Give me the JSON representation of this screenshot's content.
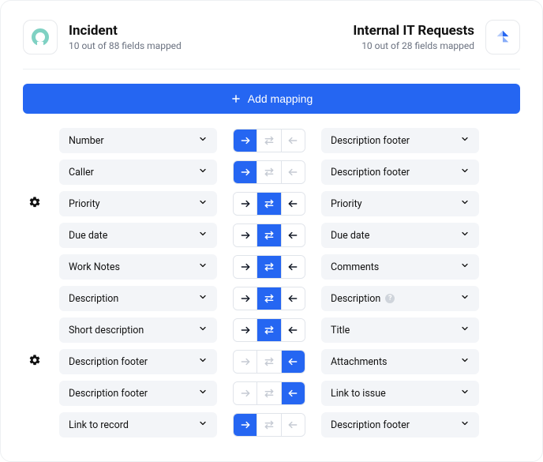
{
  "left": {
    "title": "Incident",
    "subtitle": "10 out of 88 fields mapped"
  },
  "right": {
    "title": "Internal IT Requests",
    "subtitle": "10 out of 28 fields mapped"
  },
  "add_mapping_label": "Add mapping",
  "rows": [
    {
      "gear": false,
      "left": "Number",
      "active": "right",
      "mutedOthers": true,
      "right": "Description footer",
      "help": false
    },
    {
      "gear": false,
      "left": "Caller",
      "active": "right",
      "mutedOthers": true,
      "right": "Description footer",
      "help": false
    },
    {
      "gear": true,
      "left": "Priority",
      "active": "both",
      "mutedOthers": false,
      "right": "Priority",
      "help": false
    },
    {
      "gear": false,
      "left": "Due date",
      "active": "both",
      "mutedOthers": false,
      "right": "Due date",
      "help": false
    },
    {
      "gear": false,
      "left": "Work Notes",
      "active": "both",
      "mutedOthers": false,
      "right": "Comments",
      "help": false
    },
    {
      "gear": false,
      "left": "Description",
      "active": "both",
      "mutedOthers": false,
      "right": "Description",
      "help": true
    },
    {
      "gear": false,
      "left": "Short description",
      "active": "both",
      "mutedOthers": false,
      "right": "Title",
      "help": false
    },
    {
      "gear": true,
      "left": "Description footer",
      "active": "left",
      "mutedOthers": true,
      "right": "Attachments",
      "help": false
    },
    {
      "gear": false,
      "left": "Description footer",
      "active": "left",
      "mutedOthers": true,
      "right": "Link to issue",
      "help": false
    },
    {
      "gear": false,
      "left": "Link to record",
      "active": "right",
      "mutedOthers": true,
      "right": "Description footer",
      "help": false
    }
  ]
}
